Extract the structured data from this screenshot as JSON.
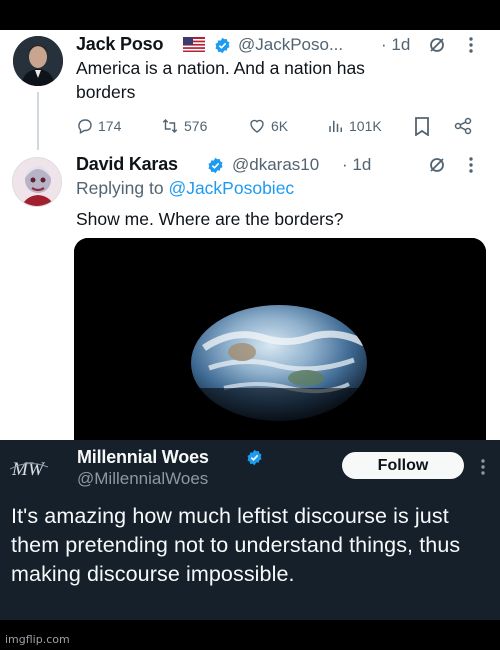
{
  "tweet_1": {
    "author_name": "Jack Poso",
    "handle": "@JackPoso...",
    "time": "· 1d",
    "text": "America is a nation. And a nation has borders",
    "stats": {
      "replies": "174",
      "reposts": "576",
      "likes": "6K",
      "views": "101K"
    }
  },
  "tweet_2": {
    "author_name": "David Karas",
    "handle": "@dkaras10",
    "time": "· 1d",
    "replying_prefix": "Replying to",
    "replying_to": "@JackPosobiec",
    "text": "Show me. Where are the borders?"
  },
  "quote_tweet": {
    "author_name": "Millennial Woes",
    "handle": "@MillennialWoes",
    "logo_text": "MW",
    "follow_label": "Follow",
    "text": "It's amazing how much leftist discourse is just them pretending not to understand things, thus making discourse impossible."
  },
  "watermark": "imgflip.com",
  "colors": {
    "accent": "#1d9bf0",
    "dark_bg": "#15202b",
    "text_muted": "#536471"
  }
}
